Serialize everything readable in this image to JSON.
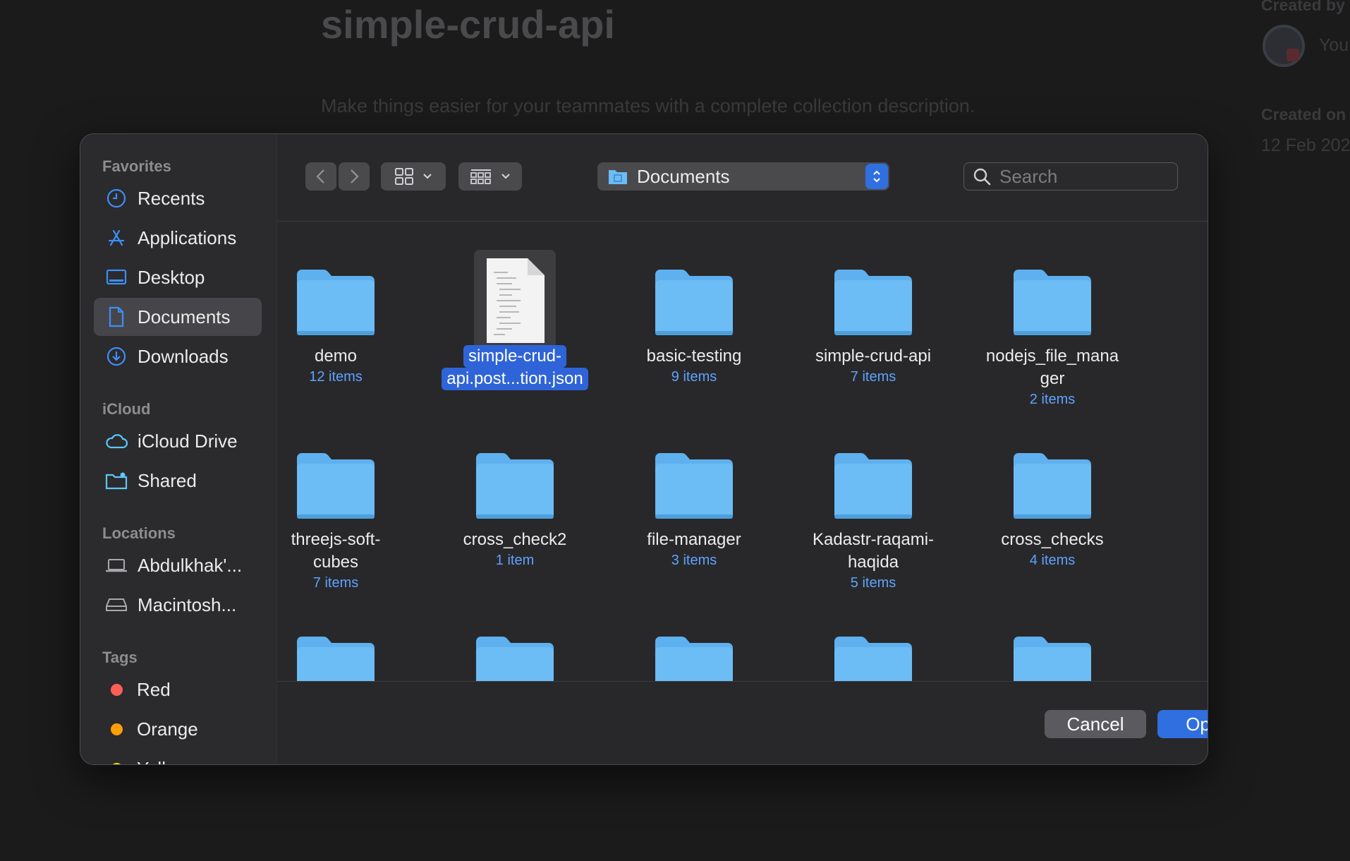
{
  "background_app": {
    "title": "simple-crud-api",
    "description": "Make things easier for your teammates with a complete collection description.",
    "created_by_label": "Created by",
    "created_by_user": "You",
    "created_on_label": "Created on",
    "created_on_value": "12 Feb 202"
  },
  "sidebar": {
    "favorites_label": "Favorites",
    "favorites": [
      {
        "label": "Recents",
        "icon": "clock-icon"
      },
      {
        "label": "Applications",
        "icon": "applications-icon"
      },
      {
        "label": "Desktop",
        "icon": "desktop-icon"
      },
      {
        "label": "Documents",
        "icon": "document-icon",
        "selected": true
      },
      {
        "label": "Downloads",
        "icon": "download-icon"
      }
    ],
    "icloud_label": "iCloud",
    "icloud": [
      {
        "label": "iCloud Drive",
        "icon": "cloud-icon"
      },
      {
        "label": "Shared",
        "icon": "shared-folder-icon"
      }
    ],
    "locations_label": "Locations",
    "locations": [
      {
        "label": "Abdulkhak'...",
        "icon": "laptop-icon"
      },
      {
        "label": "Macintosh...",
        "icon": "drive-icon"
      }
    ],
    "tags_label": "Tags",
    "tags": [
      {
        "label": "Red",
        "color": "#ff5f57"
      },
      {
        "label": "Orange",
        "color": "#ff9f0a"
      },
      {
        "label": "Yellow",
        "color": "#ffd60a"
      }
    ]
  },
  "toolbar": {
    "current_folder": "Documents",
    "search_placeholder": "Search"
  },
  "files": [
    {
      "name": "demo",
      "count": "12 items",
      "type": "folder"
    },
    {
      "name": "simple-crud-\napi.post...tion.json",
      "count": "",
      "type": "file",
      "selected": true
    },
    {
      "name": "basic-testing",
      "count": "9 items",
      "type": "folder"
    },
    {
      "name": "simple-crud-api",
      "count": "7 items",
      "type": "folder"
    },
    {
      "name": "nodejs_file_mana\nger",
      "count": "2 items",
      "type": "folder"
    },
    {
      "name": "threejs-soft-\ncubes",
      "count": "7 items",
      "type": "folder"
    },
    {
      "name": "cross_check2",
      "count": "1 item",
      "type": "folder"
    },
    {
      "name": "file-manager",
      "count": "3 items",
      "type": "folder"
    },
    {
      "name": "Kadastr-raqami-\nhaqida",
      "count": "5 items",
      "type": "folder"
    },
    {
      "name": "cross_checks",
      "count": "4 items",
      "type": "folder"
    },
    {
      "name": "",
      "count": "",
      "type": "folder"
    },
    {
      "name": "",
      "count": "",
      "type": "folder"
    },
    {
      "name": "",
      "count": "",
      "type": "folder"
    },
    {
      "name": "",
      "count": "",
      "type": "folder"
    },
    {
      "name": "",
      "count": "",
      "type": "folder"
    }
  ],
  "footer": {
    "cancel_label": "Cancel",
    "open_label": "Open"
  },
  "colors": {
    "accent": "#2f6fe0",
    "folder": "#6cbcf5",
    "item_count": "#5ea2ff"
  }
}
